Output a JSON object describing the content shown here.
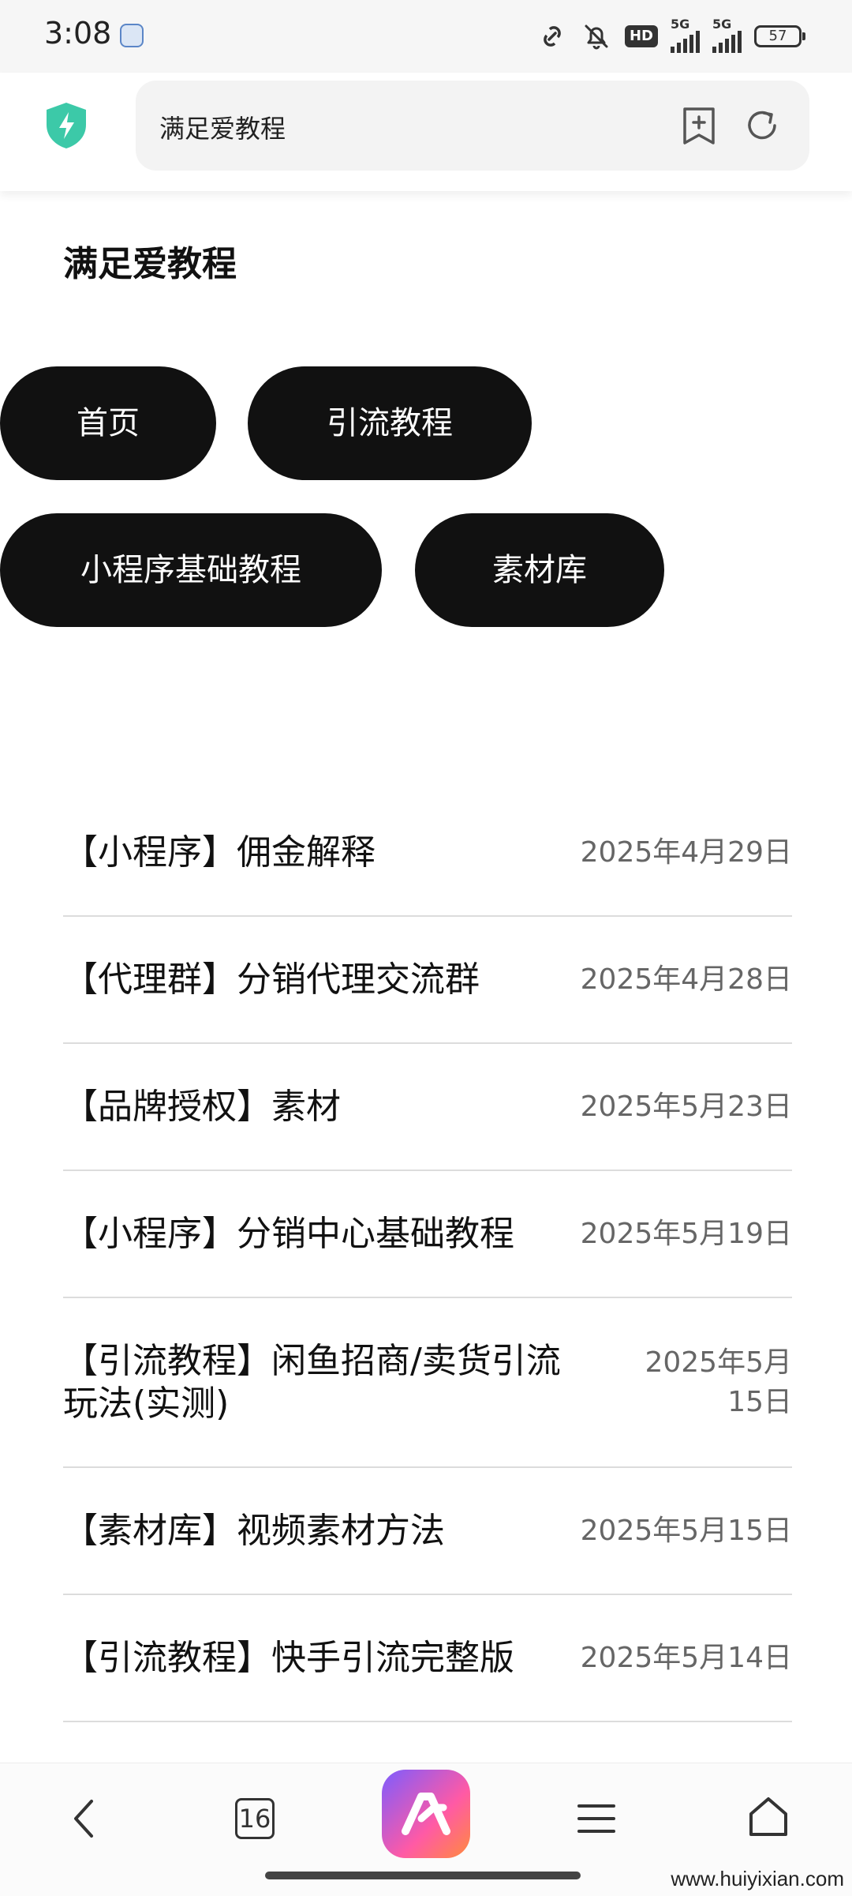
{
  "status_bar": {
    "time": "3:08",
    "hd_label": "HD",
    "signal1_label": "5G",
    "signal2_label": "5G",
    "battery": "57"
  },
  "browser": {
    "url_text": "满足爱教程",
    "tab_count": "16"
  },
  "page": {
    "site_title": "满足爱教程",
    "nav_pills": [
      {
        "label": "首页"
      },
      {
        "label": "引流教程"
      },
      {
        "label": "小程序基础教程"
      },
      {
        "label": "素材库"
      }
    ],
    "articles": [
      {
        "title": "【小程序】佣金解释",
        "date": "2025年4月29日"
      },
      {
        "title": "【代理群】分销代理交流群",
        "date": "2025年4月28日"
      },
      {
        "title": "【品牌授权】素材",
        "date": "2025年5月23日"
      },
      {
        "title": "【小程序】分销中心基础教程",
        "date": "2025年5月19日"
      },
      {
        "title": "【引流教程】闲鱼招商/卖货引流玩法(实测)",
        "date": "2025年5月15日"
      },
      {
        "title": "【素材库】视频素材方法",
        "date": "2025年5月15日"
      },
      {
        "title": "【引流教程】快手引流完整版",
        "date": "2025年5月14日"
      }
    ]
  },
  "watermark": "www.huiyixian.com",
  "colors": {
    "pill_bg": "#111111",
    "accent_shield": "#3cc9a8",
    "ai_gradient_start": "#7c5cff",
    "ai_gradient_end": "#ff8a3d"
  }
}
